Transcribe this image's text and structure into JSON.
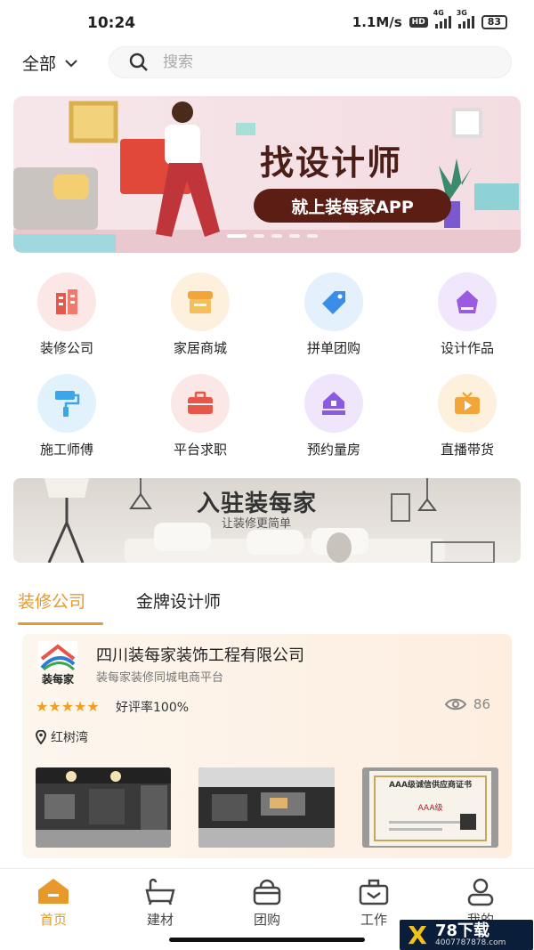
{
  "status": {
    "time": "10:24",
    "speed": "1.1M/s",
    "hd": "HD",
    "net1": "4G",
    "net2": "3G",
    "battery": "83"
  },
  "header": {
    "category": "全部",
    "search_placeholder": "搜索"
  },
  "banner": {
    "headline": "找设计师",
    "button": "就上装每家APP"
  },
  "categories": [
    {
      "label": "装修公司",
      "icon": "building-icon",
      "color": "#e8564a"
    },
    {
      "label": "家居商城",
      "icon": "store-icon",
      "color": "#f3a53a"
    },
    {
      "label": "拼单团购",
      "icon": "tag-icon",
      "color": "#3a8ee8"
    },
    {
      "label": "设计作品",
      "icon": "pen-nib-icon",
      "color": "#9b5ae0"
    },
    {
      "label": "施工师傅",
      "icon": "paint-roller-icon",
      "color": "#3aa6e8"
    },
    {
      "label": "平台求职",
      "icon": "briefcase-icon",
      "color": "#e8564a"
    },
    {
      "label": "预约量房",
      "icon": "house-measure-icon",
      "color": "#8a5ae0"
    },
    {
      "label": "直播带货",
      "icon": "tv-play-icon",
      "color": "#f3a53a"
    }
  ],
  "promo": {
    "title": "入驻装每家",
    "subtitle": "让装修更简单"
  },
  "tabs": [
    {
      "label": "装修公司"
    },
    {
      "label": "金牌设计师"
    }
  ],
  "company": {
    "logo_text": "装每家",
    "name": "四川装每家装饰工程有限公司",
    "tagline": "装每家装修同城电商平台",
    "stars": "★★★★★",
    "rating": "好评率100%",
    "views": "86",
    "location": "红树湾",
    "cert_title": "AAA级诚信供应商证书",
    "cert_grade": "AAA级"
  },
  "nav": [
    {
      "label": "首页",
      "icon": "home-icon"
    },
    {
      "label": "建材",
      "icon": "bathtub-icon"
    },
    {
      "label": "团购",
      "icon": "basket-icon"
    },
    {
      "label": "工作",
      "icon": "briefcase-icon"
    },
    {
      "label": "我的",
      "icon": "user-icon"
    }
  ],
  "watermark": {
    "mark": "X",
    "name": "78下载",
    "url": "4007787878.com"
  },
  "colors": {
    "accent": "#e79a2b",
    "banner_text": "#4a1d17"
  }
}
